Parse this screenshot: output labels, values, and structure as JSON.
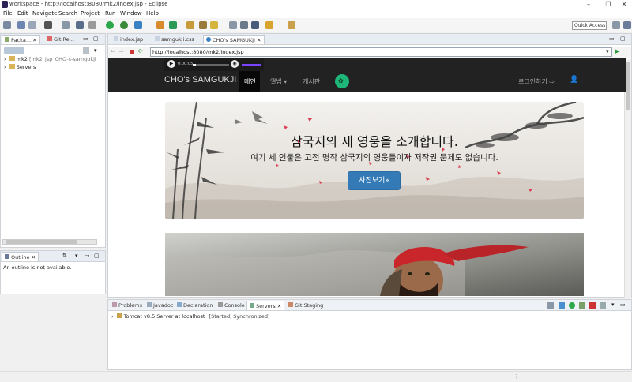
{
  "window": {
    "title": "workspace - http://localhost:8080/mk2/index.jsp - Eclipse"
  },
  "menu": [
    "File",
    "Edit",
    "Navigate",
    "Search",
    "Project",
    "Run",
    "Window",
    "Help"
  ],
  "toolbar": {
    "quick_access": "Quick Access"
  },
  "explorer": {
    "tabs": [
      "Packa...",
      "Git Re..."
    ],
    "items": [
      {
        "label": "mk2",
        "detail": "[mk2_jsp_CHO-s-samgukji"
      },
      {
        "label": "Servers",
        "detail": ""
      }
    ]
  },
  "outline": {
    "tab": "Outline",
    "message": "An outline is not available."
  },
  "editor": {
    "tabs": [
      "index.jsp",
      "samgukji.css",
      "CHO's SAMGUKJI"
    ],
    "url": "http://localhost:8080/mk2/index.jsp"
  },
  "player": {
    "time": "0:00:05"
  },
  "site": {
    "brand": "CHO's SAMGUKJI",
    "nav": [
      "메인",
      "앨범",
      "게시판"
    ],
    "login": "로그인하기",
    "heading": "삼국지의 세 영웅을 소개합니다.",
    "subheading": "여기 세 인물은 고전 명작 삼국지의 영웅들이자 저작권 문제도 없습니다.",
    "button": "사진보기»"
  },
  "bottom": {
    "tabs": [
      "Problems",
      "Javadoc",
      "Declaration",
      "Console",
      "Servers",
      "Git Staging"
    ],
    "server": {
      "name": "Tomcat v8.5 Server at localhost",
      "status": "[Started, Synchronized]"
    }
  },
  "colors": {
    "navbar": "#222222",
    "primary_button": "#337ab7",
    "logo_circle": "#1fb67a"
  }
}
